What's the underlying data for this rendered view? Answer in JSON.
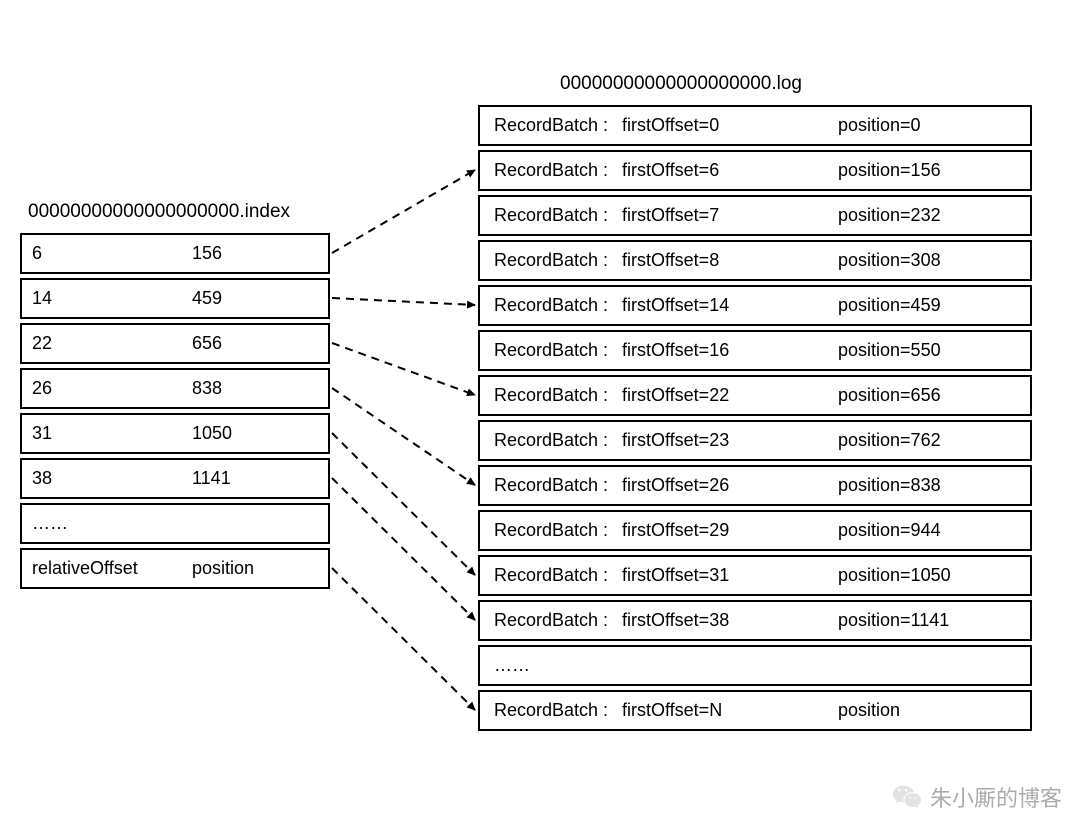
{
  "index": {
    "title": "00000000000000000000.index",
    "rows": [
      {
        "relativeOffset": "6",
        "position": "156"
      },
      {
        "relativeOffset": "14",
        "position": "459"
      },
      {
        "relativeOffset": "22",
        "position": "656"
      },
      {
        "relativeOffset": "26",
        "position": "838"
      },
      {
        "relativeOffset": "31",
        "position": "1050"
      },
      {
        "relativeOffset": "38",
        "position": "1141"
      }
    ],
    "ellipsis": "……",
    "footer": {
      "col1": "relativeOffset",
      "col2": "position"
    }
  },
  "log": {
    "title": "00000000000000000000.log",
    "prefix": "RecordBatch :",
    "rows": [
      {
        "firstOffset": "firstOffset=0",
        "position": "position=0"
      },
      {
        "firstOffset": "firstOffset=6",
        "position": "position=156"
      },
      {
        "firstOffset": "firstOffset=7",
        "position": "position=232"
      },
      {
        "firstOffset": "firstOffset=8",
        "position": "position=308"
      },
      {
        "firstOffset": "firstOffset=14",
        "position": "position=459"
      },
      {
        "firstOffset": "firstOffset=16",
        "position": "position=550"
      },
      {
        "firstOffset": "firstOffset=22",
        "position": "position=656"
      },
      {
        "firstOffset": "firstOffset=23",
        "position": "position=762"
      },
      {
        "firstOffset": "firstOffset=26",
        "position": "position=838"
      },
      {
        "firstOffset": "firstOffset=29",
        "position": "position=944"
      },
      {
        "firstOffset": "firstOffset=31",
        "position": "position=1050"
      },
      {
        "firstOffset": "firstOffset=38",
        "position": "position=1141"
      }
    ],
    "ellipsis": "……",
    "last": {
      "firstOffset": "firstOffset=N",
      "position": "position"
    }
  },
  "watermark": "朱小厮的博客",
  "mappings": [
    {
      "indexRow": 0,
      "logRow": 1
    },
    {
      "indexRow": 1,
      "logRow": 4
    },
    {
      "indexRow": 2,
      "logRow": 6
    },
    {
      "indexRow": 3,
      "logRow": 8
    },
    {
      "indexRow": 4,
      "logRow": 10
    },
    {
      "indexRow": 5,
      "logRow": 11
    }
  ],
  "chart_data": {
    "type": "table",
    "title": "Kafka .index to .log offset mapping",
    "index_file": "00000000000000000000.index",
    "log_file": "00000000000000000000.log",
    "index_entries": [
      {
        "relativeOffset": 6,
        "position": 156
      },
      {
        "relativeOffset": 14,
        "position": 459
      },
      {
        "relativeOffset": 22,
        "position": 656
      },
      {
        "relativeOffset": 26,
        "position": 838
      },
      {
        "relativeOffset": 31,
        "position": 1050
      },
      {
        "relativeOffset": 38,
        "position": 1141
      }
    ],
    "log_record_batches": [
      {
        "firstOffset": 0,
        "position": 0
      },
      {
        "firstOffset": 6,
        "position": 156
      },
      {
        "firstOffset": 7,
        "position": 232
      },
      {
        "firstOffset": 8,
        "position": 308
      },
      {
        "firstOffset": 14,
        "position": 459
      },
      {
        "firstOffset": 16,
        "position": 550
      },
      {
        "firstOffset": 22,
        "position": 656
      },
      {
        "firstOffset": 23,
        "position": 762
      },
      {
        "firstOffset": 26,
        "position": 838
      },
      {
        "firstOffset": 29,
        "position": 944
      },
      {
        "firstOffset": 31,
        "position": 1050
      },
      {
        "firstOffset": 38,
        "position": 1141
      }
    ],
    "mappings": [
      {
        "indexRelativeOffset": 6,
        "logFirstOffset": 6
      },
      {
        "indexRelativeOffset": 14,
        "logFirstOffset": 14
      },
      {
        "indexRelativeOffset": 22,
        "logFirstOffset": 22
      },
      {
        "indexRelativeOffset": 26,
        "logFirstOffset": 26
      },
      {
        "indexRelativeOffset": 31,
        "logFirstOffset": 31
      },
      {
        "indexRelativeOffset": 38,
        "logFirstOffset": 38
      }
    ]
  }
}
